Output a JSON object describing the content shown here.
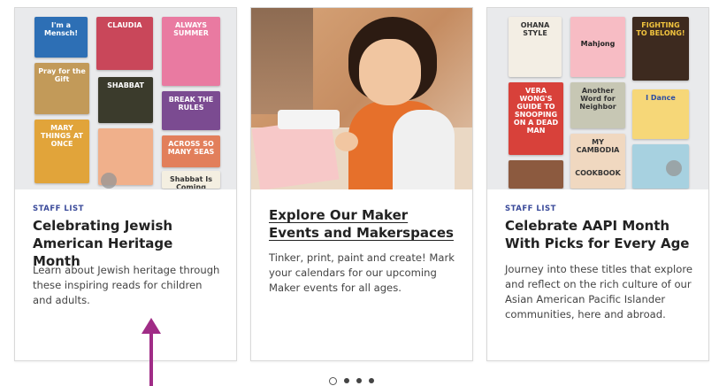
{
  "cards": [
    {
      "eyebrow": "STAFF LIST",
      "title": "Celebrating Jewish American Heritage Month",
      "description": "Learn about Jewish heritage through these inspiring reads for children and adults.",
      "book_covers": [
        "I'm a Mensch!",
        "CLAUDIA",
        "ALWAYS SUMMER",
        "Pray for the Gift",
        "SHABBAT",
        "BREAK THE RULES",
        "MARY THINGS AT ONCE",
        "ACROSS SO MANY SEAS",
        "Shabbat Is Coming"
      ]
    },
    {
      "eyebrow": "",
      "title": "Explore Our Maker Events and Makerspaces",
      "description": "Tinker, print, paint and create! Mark your calendars for our upcoming Maker events for all ages."
    },
    {
      "eyebrow": "STAFF LIST",
      "title": "Celebrate AAPI Month With Picks for Every Age",
      "description": "Journey into these titles that explore and reflect on the rich culture of our Asian American Pacific Islander communities, here and abroad.",
      "book_covers": [
        "OHANA STYLE",
        "Mahjong",
        "FIGHTING TO BELONG!",
        "VERA WONG'S GUIDE TO SNOOPING ON A DEAD MAN",
        "Another Word for Neighbor",
        "I Dance",
        "MY CAMBODIA",
        "COOKBOOK"
      ]
    }
  ],
  "carousel": {
    "page_count": 4,
    "active_page": 1
  },
  "colors": {
    "eyebrow": "#3a4a9a",
    "annotation_arrow": "#a02c86",
    "border": "#d9d9d9"
  }
}
